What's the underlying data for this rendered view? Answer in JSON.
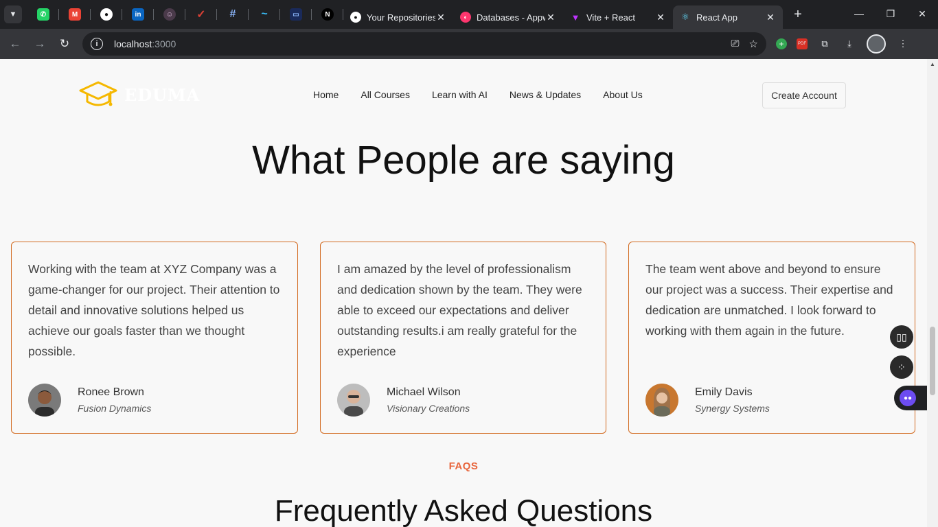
{
  "browser": {
    "pinned_tabs": [
      {
        "icon": "whatsapp-icon",
        "color": "#25d366",
        "glyph": "✆"
      },
      {
        "icon": "gmail-icon",
        "color": "#ea4335",
        "glyph": "M"
      },
      {
        "icon": "github-icon",
        "color": "#ffffff",
        "glyph": "●"
      },
      {
        "icon": "linkedin-icon",
        "color": "#0a66c2",
        "glyph": "in"
      },
      {
        "icon": "chat-icon",
        "color": "#c8a2c8",
        "glyph": "☺"
      },
      {
        "icon": "todoist-icon",
        "color": "#db4035",
        "glyph": "✓"
      },
      {
        "icon": "hashtag-icon",
        "color": "#8ab4f8",
        "glyph": "#"
      },
      {
        "icon": "tailwind-icon",
        "color": "#38bdf8",
        "glyph": "~"
      },
      {
        "icon": "app-icon",
        "color": "#1a73e8",
        "glyph": "▭"
      },
      {
        "icon": "nextjs-icon",
        "color": "#000000",
        "glyph": "N"
      }
    ],
    "tabs": [
      {
        "title": "Your Repositories",
        "icon": "github-icon",
        "color": "#ffffff",
        "glyph": "●"
      },
      {
        "title": "Databases - Appwrite",
        "icon": "appwrite-icon",
        "color": "#fd366e",
        "glyph": "◐"
      },
      {
        "title": "Vite + React",
        "icon": "vite-icon",
        "color": "#bd34fe",
        "glyph": "▼"
      },
      {
        "title": "React App",
        "icon": "react-icon",
        "color": "#61dafb",
        "glyph": "⚛",
        "active": true
      }
    ],
    "url": {
      "host": "localhost",
      "port": ":3000"
    }
  },
  "nav": {
    "logo_text": "EDUMA",
    "links": [
      "Home",
      "All Courses",
      "Learn with AI",
      "News & Updates",
      "About Us"
    ],
    "cta": "Create Account"
  },
  "headline": "What People are saying",
  "testimonials": [
    {
      "quote": "Working with the team at XYZ Company was a game-changer for our project. Their attention to detail and innovative solutions helped us achieve our goals faster than we thought possible.",
      "name": "Ronee Brown",
      "company": "Fusion Dynamics"
    },
    {
      "quote": "I am amazed by the level of professionalism and dedication shown by the team. They were able to exceed our expectations and deliver outstanding results.i am really grateful for the experience",
      "name": "Michael Wilson",
      "company": "Visionary Creations"
    },
    {
      "quote": "The team went above and beyond to ensure our project was a success. Their expertise and dedication are unmatched. I look forward to working with them again in the future.",
      "name": "Emily Davis",
      "company": "Synergy Systems"
    }
  ],
  "faq": {
    "label": "FAQS",
    "title": "Frequently Asked Questions"
  },
  "colors": {
    "accent": "#e8663d",
    "card_border": "#d2691e",
    "logo": "#f5b800"
  }
}
